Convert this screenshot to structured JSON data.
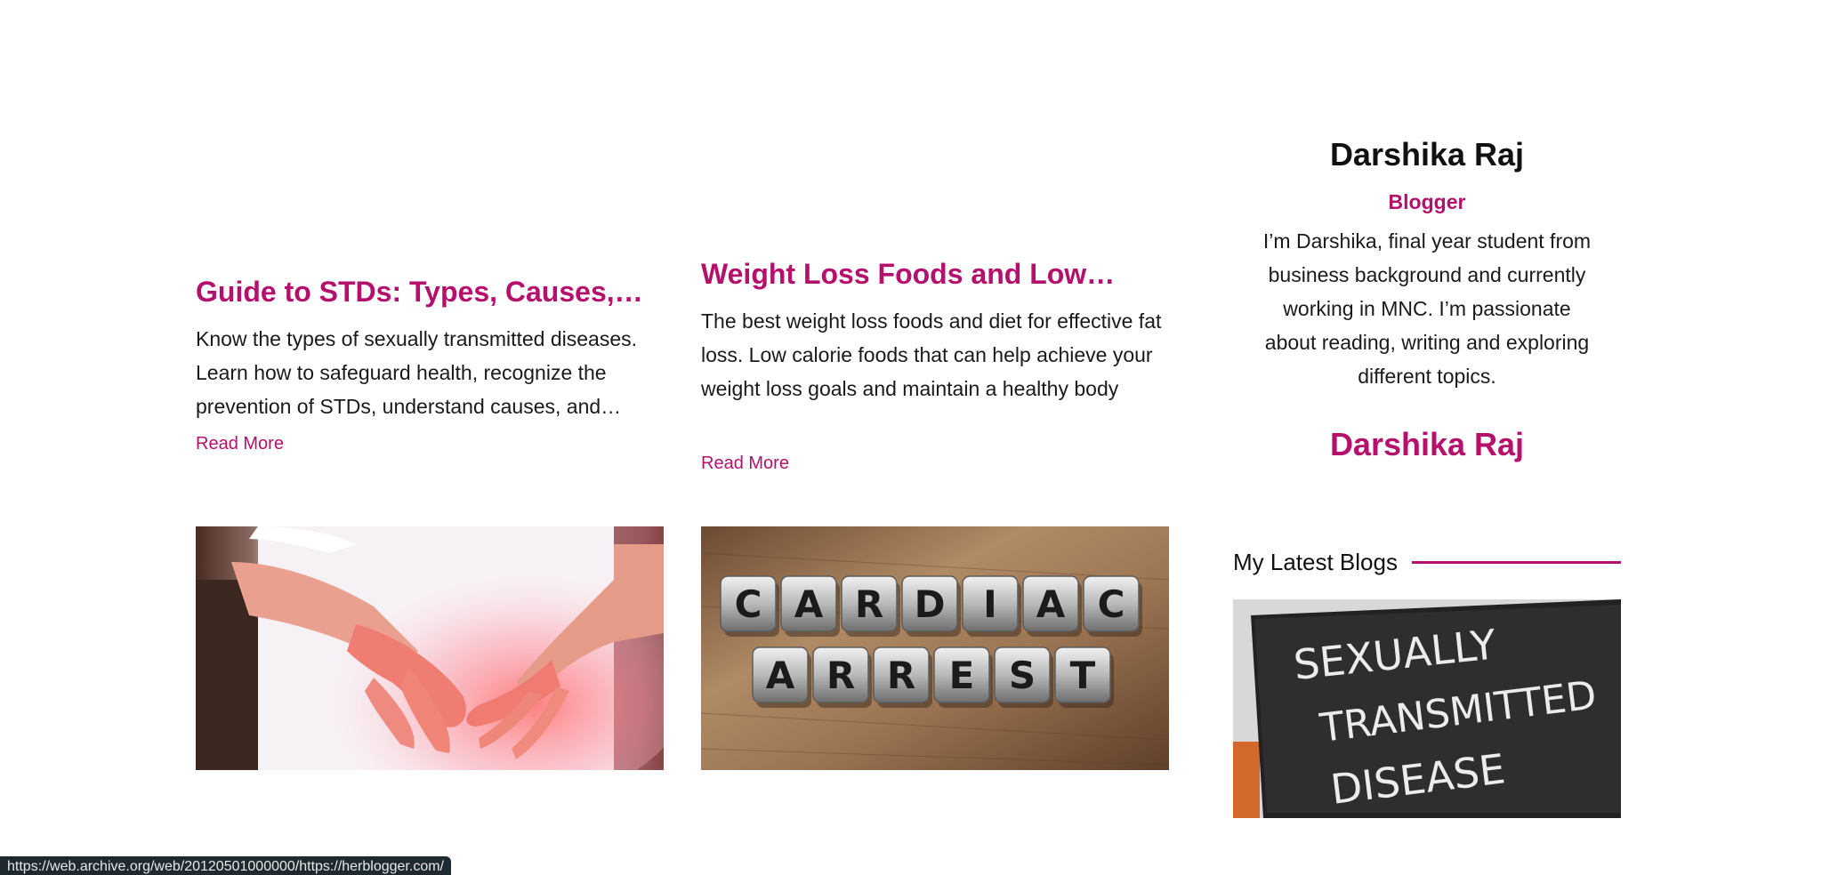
{
  "posts": [
    {
      "title": "Guide to STDs: Types, Causes,…",
      "excerpt": "Know the types of sexually transmitted diseases. Learn how to safeguard health, recognize the prevention of STDs, understand causes, and…",
      "read_more": "Read More",
      "image_subject": "hands-on-abdomen"
    },
    {
      "title": "Weight Loss Foods and Low…",
      "excerpt": "The best weight loss foods and diet for effective fat loss. Low calorie foods that can help achieve your weight loss goals and maintain a healthy body",
      "read_more": "Read More",
      "image_subject": "cardiac-arrest-cubes"
    }
  ],
  "image_text": {
    "cube_row_1": [
      "C",
      "A",
      "R",
      "D",
      "I",
      "A",
      "C"
    ],
    "cube_row_2": [
      "A",
      "R",
      "R",
      "E",
      "S",
      "T"
    ],
    "chalkboard_lines": [
      "SEXUALLY",
      "TRANSMITTED",
      "DISEASE"
    ]
  },
  "sidebar": {
    "name": "Darshika Raj",
    "role": "Blogger",
    "bio": "I’m Darshika, final year student from business background and currently working in MNC. I’m passionate about reading, writing and exploring different topics.",
    "signature": "Darshika Raj",
    "latest_blogs_heading": "My Latest Blogs"
  },
  "status_bar": {
    "url": "https://web.archive.org/web/20120501000000/https://herblogger.com/"
  },
  "colors": {
    "accent": "#b5106b",
    "text": "#1a1a1a",
    "status_bg": "#1f2a30"
  }
}
